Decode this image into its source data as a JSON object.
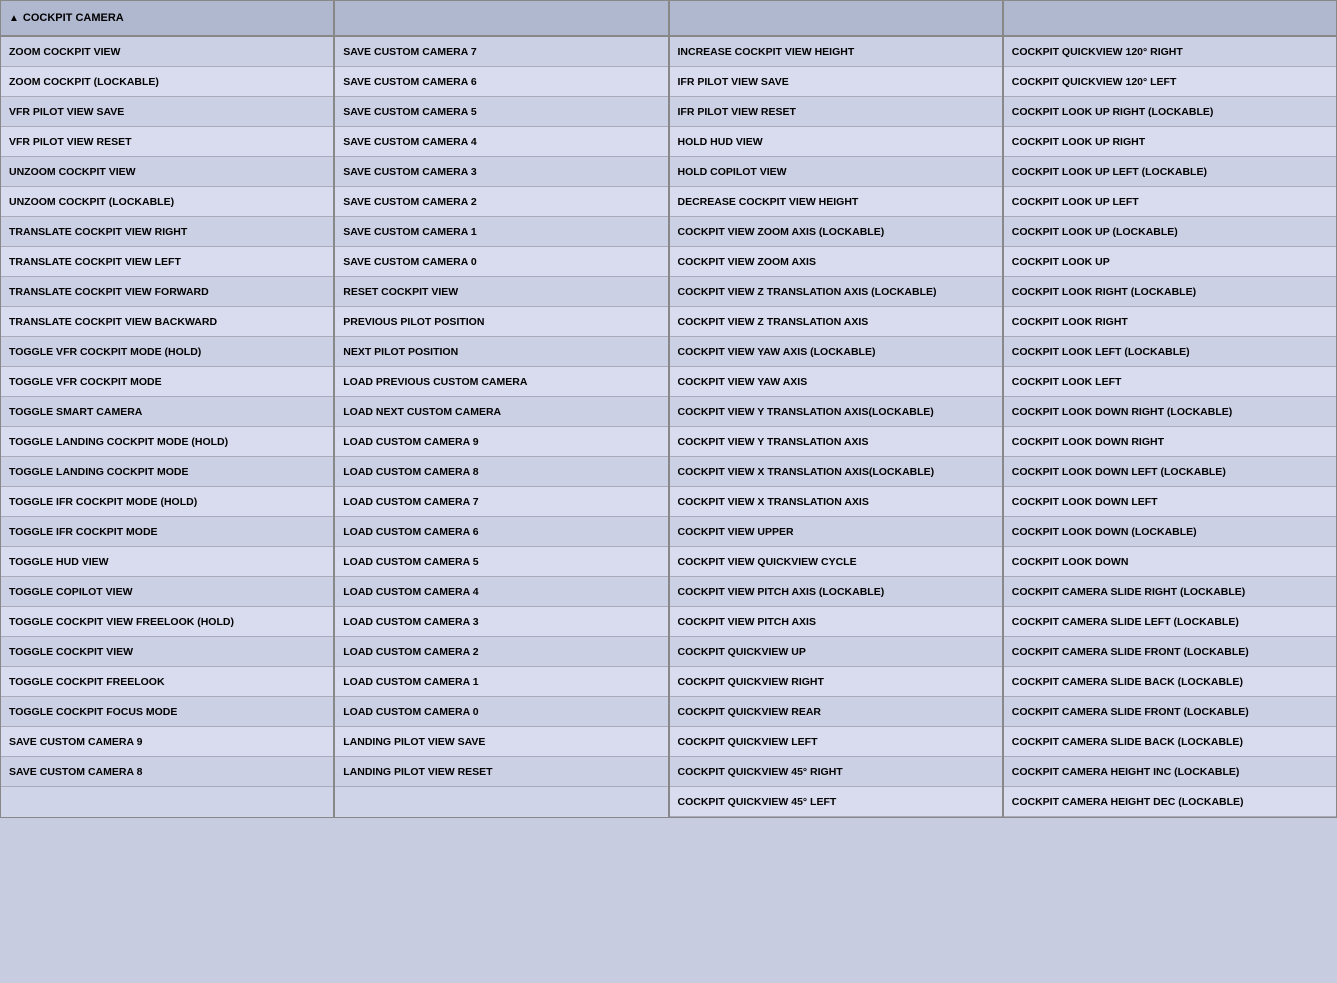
{
  "columns": [
    {
      "header": "COCKPIT CAMERA",
      "hasChevron": true,
      "items": [
        "ZOOM COCKPIT VIEW",
        "ZOOM COCKPIT (LOCKABLE)",
        "VFR PILOT VIEW SAVE",
        "VFR PILOT VIEW RESET",
        "UNZOOM COCKPIT VIEW",
        "UNZOOM COCKPIT (LOCKABLE)",
        "TRANSLATE COCKPIT VIEW RIGHT",
        "TRANSLATE COCKPIT VIEW LEFT",
        "TRANSLATE COCKPIT VIEW FORWARD",
        "TRANSLATE COCKPIT VIEW BACKWARD",
        "TOGGLE VFR COCKPIT MODE (HOLD)",
        "TOGGLE VFR COCKPIT MODE",
        "TOGGLE SMART CAMERA",
        "TOGGLE LANDING COCKPIT MODE (HOLD)",
        "TOGGLE LANDING COCKPIT MODE",
        "TOGGLE IFR COCKPIT MODE (HOLD)",
        "TOGGLE IFR COCKPIT MODE",
        "TOGGLE HUD VIEW",
        "TOGGLE COPILOT VIEW",
        "TOGGLE COCKPIT VIEW FREELOOK (HOLD)",
        "TOGGLE COCKPIT VIEW",
        "TOGGLE COCKPIT FREELOOK",
        "TOGGLE COCKPIT FOCUS MODE",
        "SAVE CUSTOM CAMERA 9",
        "SAVE CUSTOM CAMERA 8"
      ]
    },
    {
      "header": "",
      "hasChevron": false,
      "items": [
        "SAVE CUSTOM CAMERA 7",
        "SAVE CUSTOM CAMERA 6",
        "SAVE CUSTOM CAMERA 5",
        "SAVE CUSTOM CAMERA 4",
        "SAVE CUSTOM CAMERA 3",
        "SAVE CUSTOM CAMERA 2",
        "SAVE CUSTOM CAMERA 1",
        "SAVE CUSTOM CAMERA 0",
        "RESET COCKPIT VIEW",
        "PREVIOUS PILOT POSITION",
        "NEXT PILOT POSITION",
        "LOAD PREVIOUS CUSTOM CAMERA",
        "LOAD NEXT CUSTOM CAMERA",
        "LOAD CUSTOM CAMERA 9",
        "LOAD CUSTOM CAMERA 8",
        "LOAD CUSTOM CAMERA 7",
        "LOAD CUSTOM CAMERA 6",
        "LOAD CUSTOM CAMERA 5",
        "LOAD CUSTOM CAMERA 4",
        "LOAD CUSTOM CAMERA 3",
        "LOAD CUSTOM CAMERA 2",
        "LOAD CUSTOM CAMERA 1",
        "LOAD CUSTOM CAMERA 0",
        "LANDING PILOT VIEW SAVE",
        "LANDING PILOT VIEW RESET"
      ]
    },
    {
      "header": "",
      "hasChevron": false,
      "items": [
        "INCREASE COCKPIT VIEW HEIGHT",
        "IFR PILOT VIEW SAVE",
        "IFR PILOT VIEW RESET",
        "HOLD HUD VIEW",
        "HOLD COPILOT VIEW",
        "DECREASE COCKPIT VIEW HEIGHT",
        "COCKPIT VIEW ZOOM AXIS (LOCKABLE)",
        "COCKPIT VIEW ZOOM AXIS",
        "COCKPIT VIEW Z TRANSLATION AXIS (LOCKABLE)",
        "COCKPIT VIEW Z TRANSLATION AXIS",
        "COCKPIT VIEW YAW AXIS (LOCKABLE)",
        "COCKPIT VIEW YAW AXIS",
        "COCKPIT VIEW Y TRANSLATION AXIS(LOCKABLE)",
        "COCKPIT VIEW Y TRANSLATION AXIS",
        "COCKPIT VIEW X TRANSLATION AXIS(LOCKABLE)",
        "COCKPIT VIEW X TRANSLATION AXIS",
        "COCKPIT VIEW UPPER",
        "COCKPIT VIEW QUICKVIEW CYCLE",
        "COCKPIT VIEW PITCH AXIS (LOCKABLE)",
        "COCKPIT VIEW PITCH AXIS",
        "COCKPIT QUICKVIEW UP",
        "COCKPIT QUICKVIEW RIGHT",
        "COCKPIT QUICKVIEW REAR",
        "COCKPIT QUICKVIEW LEFT",
        "COCKPIT QUICKVIEW 45° RIGHT",
        "COCKPIT QUICKVIEW 45° LEFT"
      ]
    },
    {
      "header": "",
      "hasChevron": false,
      "items": [
        "COCKPIT QUICKVIEW 120° RIGHT",
        "COCKPIT QUICKVIEW 120° LEFT",
        "COCKPIT LOOK UP RIGHT (LOCKABLE)",
        "COCKPIT LOOK UP RIGHT",
        "COCKPIT LOOK UP LEFT (LOCKABLE)",
        "COCKPIT LOOK UP LEFT",
        "COCKPIT LOOK UP (LOCKABLE)",
        "COCKPIT LOOK UP",
        "COCKPIT LOOK RIGHT (LOCKABLE)",
        "COCKPIT LOOK RIGHT",
        "COCKPIT LOOK LEFT (LOCKABLE)",
        "COCKPIT LOOK LEFT",
        "COCKPIT LOOK DOWN RIGHT (LOCKABLE)",
        "COCKPIT LOOK DOWN RIGHT",
        "COCKPIT LOOK DOWN LEFT (LOCKABLE)",
        "COCKPIT LOOK DOWN LEFT",
        "COCKPIT LOOK DOWN (LOCKABLE)",
        "COCKPIT LOOK DOWN",
        "COCKPIT CAMERA SLIDE RIGHT (LOCKABLE)",
        "COCKPIT CAMERA SLIDE LEFT (LOCKABLE)",
        "COCKPIT CAMERA SLIDE FRONT (LOCKABLE)",
        "COCKPIT CAMERA SLIDE BACK (LOCKABLE)",
        "COCKPIT CAMERA SLIDE FRONT (LOCKABLE)",
        "COCKPIT CAMERA SLIDE BACK (LOCKABLE)",
        "COCKPIT CAMERA HEIGHT INC (LOCKABLE)",
        "COCKPIT CAMERA HEIGHT DEC (LOCKABLE)"
      ]
    }
  ]
}
